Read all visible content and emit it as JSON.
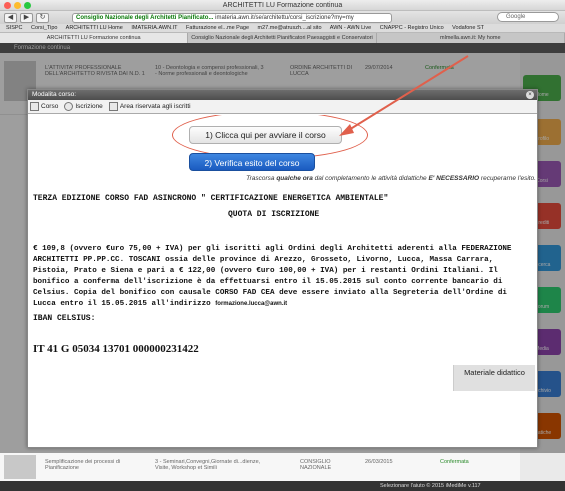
{
  "window": {
    "title": "ARCHITETTI LU Formazione continua"
  },
  "toolbar": {
    "back": "◀",
    "forward": "▶",
    "reload": "↻",
    "url_site": "Consiglio Nazionale degli Architetti Pianificato...",
    "url_path": "imateria.awn.it/se/architettu/corsi_iscrizione?my=my",
    "search_placeholder": "Google"
  },
  "bookmarks": [
    "SISPC",
    "Corsi_Tipo",
    "ARCHITETTI LU Home",
    "IMATERIA.AWN.IT",
    "Fatturazione el...me Page",
    "m27.me@atruszh....al sito",
    "AWN - AWN Live",
    "CNAPPC - Registro Unico",
    "Vodafone ST"
  ],
  "tabs": [
    "ARCHITETTI LU Formazione continua",
    "Consiglio Nazionale degli Architetti Pianificatori Paesaggisti e Conservatori",
    "mlmella.awn.it: My home"
  ],
  "app": {
    "header": "Formazione continua",
    "row1": {
      "col1": "L'ATTIVITA' PROFESSIONALE DELL'ARCHITETTO RIVISTA DAI N.D. 1",
      "col2": "10 - Deontologia e compensi professionali, 3 - Norme professionali e deontologiche",
      "col3": "ORDINE ARCHITETTI DI LUCCA",
      "date": "29/07/2014",
      "status": "Confermata"
    },
    "row_bottom": {
      "col1": "Semplificazione dei processi di Pianificazione",
      "col2": "3 - Seminari,Convegni,Giornate di...dienze, Visite, Workshop et Simili",
      "col3": "CONSIGLIO NAZIONALE",
      "date": "26/03/2015",
      "status": "Confermata"
    },
    "side_buttons": [
      {
        "label": "Home",
        "color": "#4cae4c"
      },
      {
        "label": "Profilo",
        "color": "#f0ad4e"
      },
      {
        "label": "Corsi",
        "color": "#9b59b6"
      },
      {
        "label": "Crediti",
        "color": "#e74c3c"
      },
      {
        "label": "Ricerca",
        "color": "#3498db"
      },
      {
        "label": "Forum",
        "color": "#2ecc71"
      },
      {
        "label": "Media",
        "color": "#8e44ad"
      },
      {
        "label": "Archivio",
        "color": "#3a7fd5"
      },
      {
        "label": "Pratiche",
        "color": "#d35400"
      }
    ],
    "statusbar": "Selezionare l'aiuto   © 2015 iMediMe   v.117"
  },
  "modal": {
    "title": "Modalita corso:",
    "tabs": [
      "Corso",
      "Iscrizione",
      "Area riservata agli iscritti"
    ],
    "btn_start": "1) Clicca qui per avviare il corso",
    "btn_verify": "2) Verifica esito del corso",
    "note_prefix": "Trascorsa ",
    "note_bold1": "qualche ora",
    "note_mid": " dal completamento le attività didattiche ",
    "note_bold2": "E' NECESSARIO",
    "note_suffix": " recuperarne l'esito.",
    "title1": "TERZA EDIZIONE CORSO FAD ASINCRONO \" CERTIFICAZIONE ENERGETICA AMBIENTALE\"",
    "title2": "QUOTA DI ISCRIZIONE",
    "paragraph": "€ 109,8 (ovvero €uro 75,00 + IVA) per gli iscritti agli Ordini degli Architetti  aderenti alla FEDERAZIONE ARCHITETTI PP.PP.CC. TOSCANI ossia delle province di Arezzo, Grosseto, Livorno, Lucca, Massa Carrara, Pistoia, Prato e Siena e pari a € 122,00 (ovvero €uro 100,00 + IVA) per i restanti Ordini Italiani. Il bonifico a conferma dell'iscrizione è da effettuarsi entro il 15.05.2015 sul conto corrente bancario di Celsius. Copia del bonifico con causale CORSO FAD CEA deve essere inviato alla Segreteria dell'Ordine di Lucca entro il 15.05.2015 all'indirizzo ",
    "email": "formazione.lucca@awn.it",
    "iban_label": "IBAN CELSIUS:",
    "iban": "IT 41 G 05034 13701 000000231422",
    "material": "Materiale didattico",
    "close": "×"
  },
  "colors": {
    "annotation": "#e0604c",
    "primary_button": "#2a6fd0"
  }
}
